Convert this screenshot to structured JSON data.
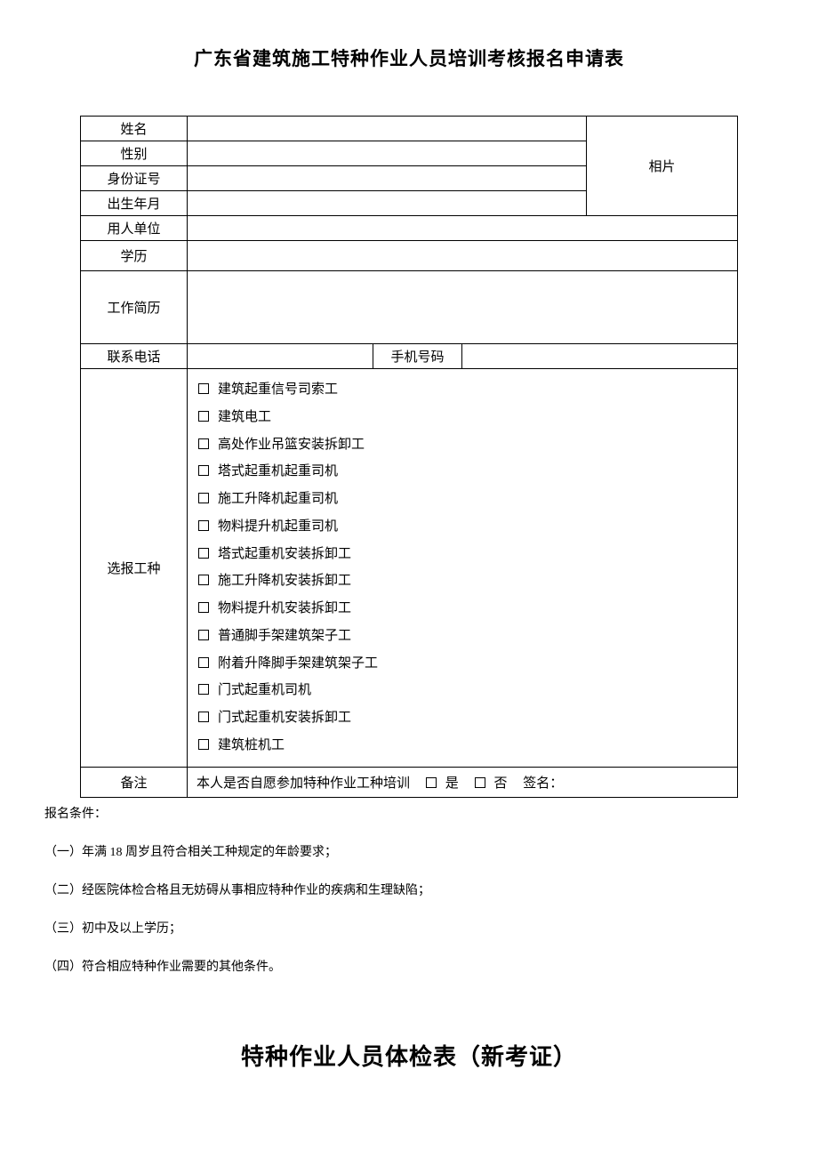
{
  "title": "广东省建筑施工特种作业人员培训考核报名申请表",
  "labels": {
    "name": "姓名",
    "gender": "性别",
    "id_no": "身份证号",
    "birth": "出生年月",
    "employer": "用人单位",
    "education": "学历",
    "resume": "工作简历",
    "phone": "联系电话",
    "mobile": "手机号码",
    "job_type": "选报工种",
    "remark": "备注",
    "photo": "相片"
  },
  "job_types": [
    "建筑起重信号司索工",
    "建筑电工",
    "高处作业吊篮安装拆卸工",
    "塔式起重机起重司机",
    "施工升降机起重司机",
    "物料提升机起重司机",
    "塔式起重机安装拆卸工",
    "施工升降机安装拆卸工",
    "物料提升机安装拆卸工",
    "普通脚手架建筑架子工",
    "附着升降脚手架建筑架子工",
    "门式起重机司机",
    "门式起重机安装拆卸工",
    "建筑桩机工"
  ],
  "remark_text": {
    "question": "本人是否自愿参加特种作业工种培训",
    "yes": "是",
    "no": "否",
    "sign": "签名："
  },
  "conditions": {
    "head": "报名条件：",
    "items": [
      "（一）年满 18 周岁且符合相关工种规定的年龄要求；",
      "（二）经医院体检合格且无妨碍从事相应特种作业的疾病和生理缺陷；",
      "（三）初中及以上学历；",
      "（四）符合相应特种作业需要的其他条件。"
    ]
  },
  "title2": "特种作业人员体检表（新考证）"
}
